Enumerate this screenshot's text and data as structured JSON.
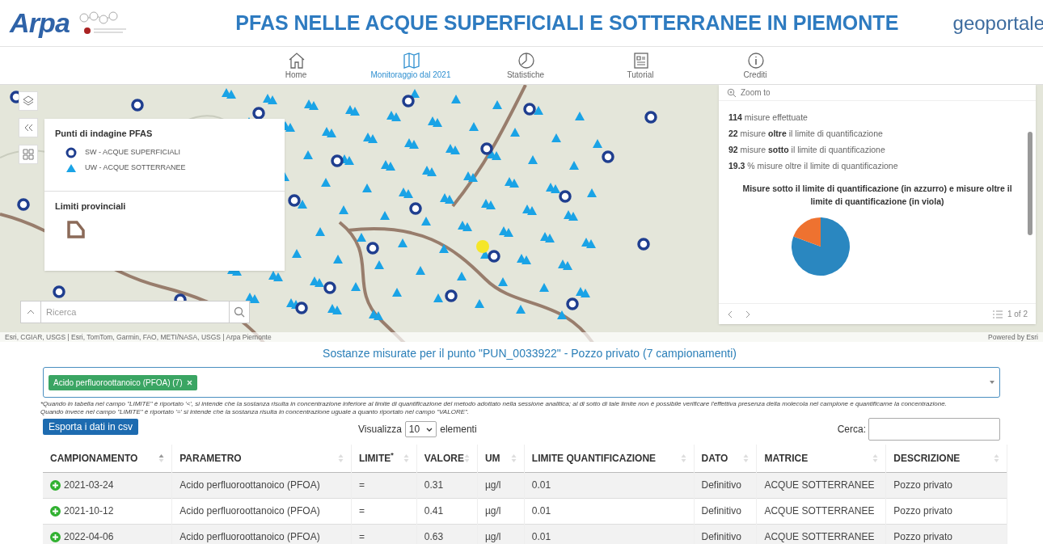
{
  "header": {
    "logo_text": "Arpa",
    "title": "PFAS NELLE ACQUE SUPERFICIALI E SOTTERRANEE IN PIEMONTE",
    "right_logo": "geoportale"
  },
  "nav": [
    {
      "label": "Home",
      "selected": false
    },
    {
      "label": "Monitoraggio dal 2021",
      "selected": true
    },
    {
      "label": "Statistiche",
      "selected": false
    },
    {
      "label": "Tutorial",
      "selected": false
    },
    {
      "label": "Crediti",
      "selected": false
    }
  ],
  "map": {
    "legend": {
      "sections": [
        {
          "title": "Punti di indagine PFAS",
          "items": [
            {
              "kind": "circle",
              "label": "SW - ACQUE SUPERFICIALI"
            },
            {
              "kind": "triangle",
              "label": "UW - ACQUE SOTTERRANEE"
            }
          ]
        },
        {
          "title": "Limiti provinciali",
          "items": [
            {
              "kind": "polygon"
            }
          ]
        }
      ]
    },
    "search": {
      "placeholder": "Ricerca"
    },
    "attribution": "Esri, CGIAR, USGS | Esri, TomTom, Garmin, FAO, METI/NASA, USGS | Arpa Piemonte",
    "powered_by": "Powered by Esri",
    "popup": {
      "zoom_to": "Zoom to",
      "stats": [
        "**114** misure effettuate",
        "**22** misure **oltre** il limite di quantificazione",
        "**92** misure **sotto** il limite di quantificazione",
        "**19.3** % misure oltre il limite di quantificazione"
      ],
      "chart_data": {
        "type": "pie",
        "title": "Misure sotto il limite di quantificazione (in azzurro) e misure oltre il limite di quantificazione (in viola)",
        "values": [
          80.7,
          19.3
        ],
        "colors": [
          "#2a87c0",
          "#ee7230"
        ]
      },
      "pager": "1 of 2"
    }
  },
  "panel": {
    "heading": "Sostanze misurate per il punto \"PUN_0033922\" - Pozzo privato (7 campionamenti)",
    "tags": [
      "Acido perfluoroottanoico (PFOA) (7)"
    ],
    "notes": [
      "*Quando in tabella nel campo \"LIMITE\" è riportato '<', si intende che la sostanza risulta in concentrazione inferiore al limite di quantificazione del metodo adottato nella sessione analitica; al di sotto di tale limite non è possibile verificare l'effettiva presenza della molecola nel campione e quantificarne la concentrazione.",
      "Quando invece nel campo \"LIMITE\" è riportato '=' si intende che la sostanza risulta in concentrazione uguale a quanto riportato nel campo \"VALORE\"."
    ],
    "export_button": "Esporta i dati in csv",
    "show_label": "Visualizza",
    "show_value": "10",
    "show_suffix": "elementi",
    "search_label": "Cerca:"
  },
  "table": {
    "columns": [
      {
        "label": "CAMPIONAMENTO",
        "sorted": true
      },
      {
        "label": "PARAMETRO",
        "sorted": false
      },
      {
        "label": "LIMITE",
        "mark": "*",
        "sorted": false
      },
      {
        "label": "VALORE",
        "sorted": false
      },
      {
        "label": "UM",
        "sorted": false
      },
      {
        "label": "LIMITE QUANTIFICAZIONE",
        "sorted": false
      },
      {
        "label": "DATO",
        "sorted": false
      },
      {
        "label": "MATRICE",
        "sorted": false
      },
      {
        "label": "DESCRIZIONE",
        "sorted": false
      }
    ],
    "rows": [
      [
        "2021-03-24",
        "Acido perfluoroottanoico (PFOA)",
        "=",
        "0.31",
        "µg/l",
        "0.01",
        "Definitivo",
        "ACQUE SOTTERRANEE",
        "Pozzo privato"
      ],
      [
        "2021-10-12",
        "Acido perfluoroottanoico (PFOA)",
        "=",
        "0.41",
        "µg/l",
        "0.01",
        "Definitivo",
        "ACQUE SOTTERRANEE",
        "Pozzo privato"
      ],
      [
        "2022-04-06",
        "Acido perfluoroottanoico (PFOA)",
        "=",
        "0.63",
        "µg/l",
        "0.01",
        "Definitivo",
        "ACQUE SOTTERRANEE",
        "Pozzo privato"
      ]
    ]
  }
}
